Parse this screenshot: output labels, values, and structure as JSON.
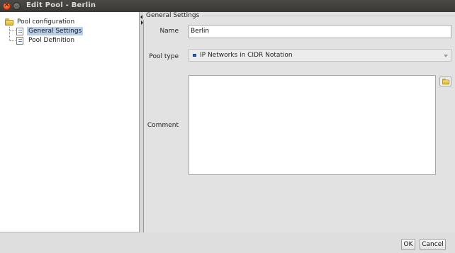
{
  "window": {
    "title": "Edit Pool - Berlin",
    "close_glyph": "×"
  },
  "tree": {
    "root": {
      "label": "Pool configuration",
      "icon": "folder-icon"
    },
    "items": [
      {
        "label": "General Settings",
        "icon": "document-icon",
        "selected": true
      },
      {
        "label": "Pool Definition",
        "icon": "document-icon",
        "selected": false
      }
    ]
  },
  "form": {
    "section_title": "General Settings",
    "name": {
      "label": "Name",
      "value": "Berlin"
    },
    "pool_type": {
      "label": "Pool type",
      "value": "IP Networks in CIDR Notation",
      "icon": "network-flag-icon"
    },
    "comment": {
      "label": "Comment",
      "value": ""
    }
  },
  "buttons": {
    "ok": "OK",
    "cancel": "Cancel"
  },
  "colors": {
    "selection": "#b9cde6",
    "titlebar": "#3a3935",
    "close_button": "#e0521f"
  }
}
